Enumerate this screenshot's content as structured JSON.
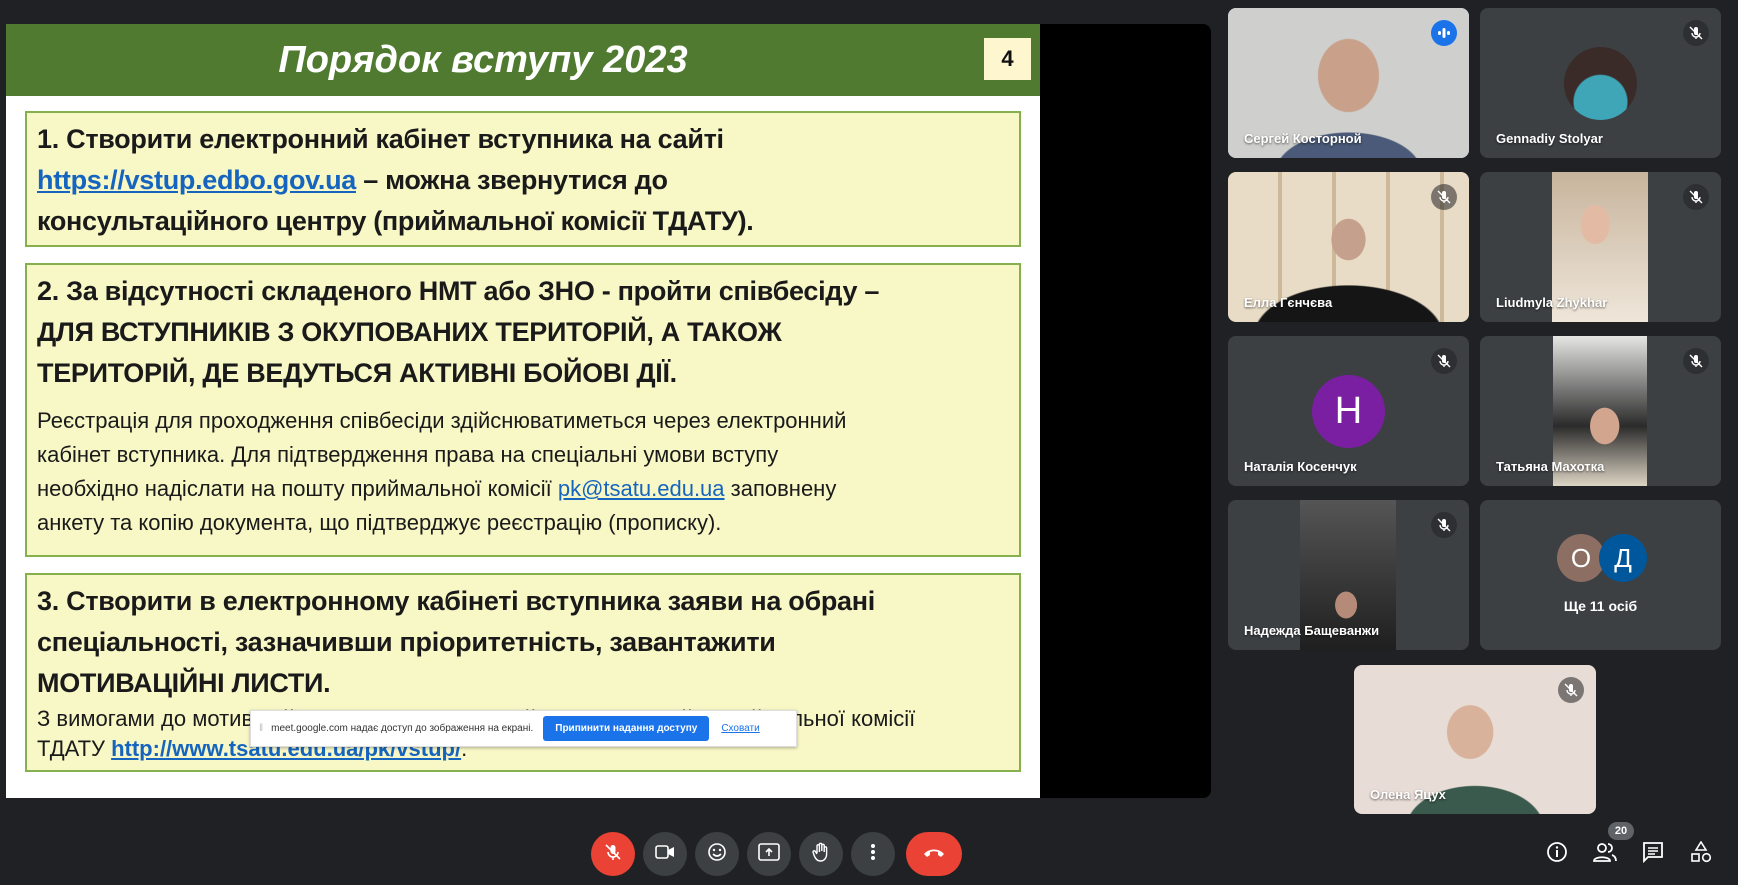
{
  "slide": {
    "title": "Порядок вступу 2023",
    "page_number": "4",
    "step1": {
      "line1": "1. Створити електронний кабінет вступника на сайті",
      "link": "https://vstup.edbo.gov.ua",
      "line2_rest": " – можна звернутися до",
      "line3": "консультаційного центру (приймальної комісії ТДАТУ)."
    },
    "step2": {
      "line1": "2. За відсутності складеного НМТ або ЗНО - пройти співбесіду –",
      "line2": "ДЛЯ ВСТУПНИКІВ З ОКУПОВАНИХ ТЕРИТОРІЙ, А ТАКОЖ",
      "line3": "ТЕРИТОРІЙ, ДЕ ВЕДУТЬСЯ АКТИВНІ БОЙОВІ ДІЇ.",
      "p1": "Реєстрація для проходження співбесіди здійснюватиметься через електронний",
      "p2": "кабінет вступника. Для підтвердження права на спеціальні умови вступу",
      "p3_start": "необхідно надіслати на пошту приймальної комісії ",
      "email": "pk@tsatu.edu.ua",
      "p3_end": " заповнену",
      "p4": "анкету та копію документа, що підтверджує реєстрацію (прописку)."
    },
    "step3": {
      "line1": "3. Створити в електронному кабінеті вступника заяви на обрані",
      "line2": "спеціальності, зазначивши пріоритетність, завантажити",
      "line3": "МОТИВАЦІЙНІ ЛИСТИ.",
      "p1": "З вимогами до мотиваційних листів можна ознайомитись на сайті приймальної комісії",
      "p2_start": "ТДАТУ ",
      "link": "http://www.tsatu.edu.ua/pk/vstup/",
      "p2_end": "."
    }
  },
  "share_popup": {
    "message": "meet.google.com надає доступ до зображення на екрані.",
    "stop_label": "Припинити надання доступу",
    "hide_label": "Сховати"
  },
  "participants": [
    {
      "name": "Сергей Косторной",
      "state": "speaking"
    },
    {
      "name": "Gennadiy Stolyar",
      "state": "muted"
    },
    {
      "name": "Елла Гєнчєва",
      "state": "muted"
    },
    {
      "name": "Liudmyla Zhykhar",
      "state": "muted"
    },
    {
      "name": "Наталія Косенчук",
      "state": "muted",
      "initial": "Н",
      "color": "#7b1fa2"
    },
    {
      "name": "Татьяна Махотка",
      "state": "muted"
    },
    {
      "name": "Надежда Бащеванжи",
      "state": "muted"
    },
    {
      "name": "Олена Яцух",
      "state": "muted"
    }
  ],
  "more": {
    "label": "Ще 11 осіб",
    "initials": [
      "О",
      "Д"
    ],
    "colors": [
      "#8d6e63",
      "#01579b"
    ]
  },
  "toolbar": {
    "buttons": [
      "mic-off",
      "camera",
      "emoji",
      "present",
      "raise-hand",
      "more-options",
      "leave-call"
    ],
    "people_count": "20",
    "right": [
      "info",
      "people",
      "chat",
      "activities"
    ]
  },
  "colors": {
    "accent": "#1a73e8",
    "danger": "#ea4335",
    "slide_header": "#4f7a30",
    "box_fill": "#f8f7c6"
  }
}
